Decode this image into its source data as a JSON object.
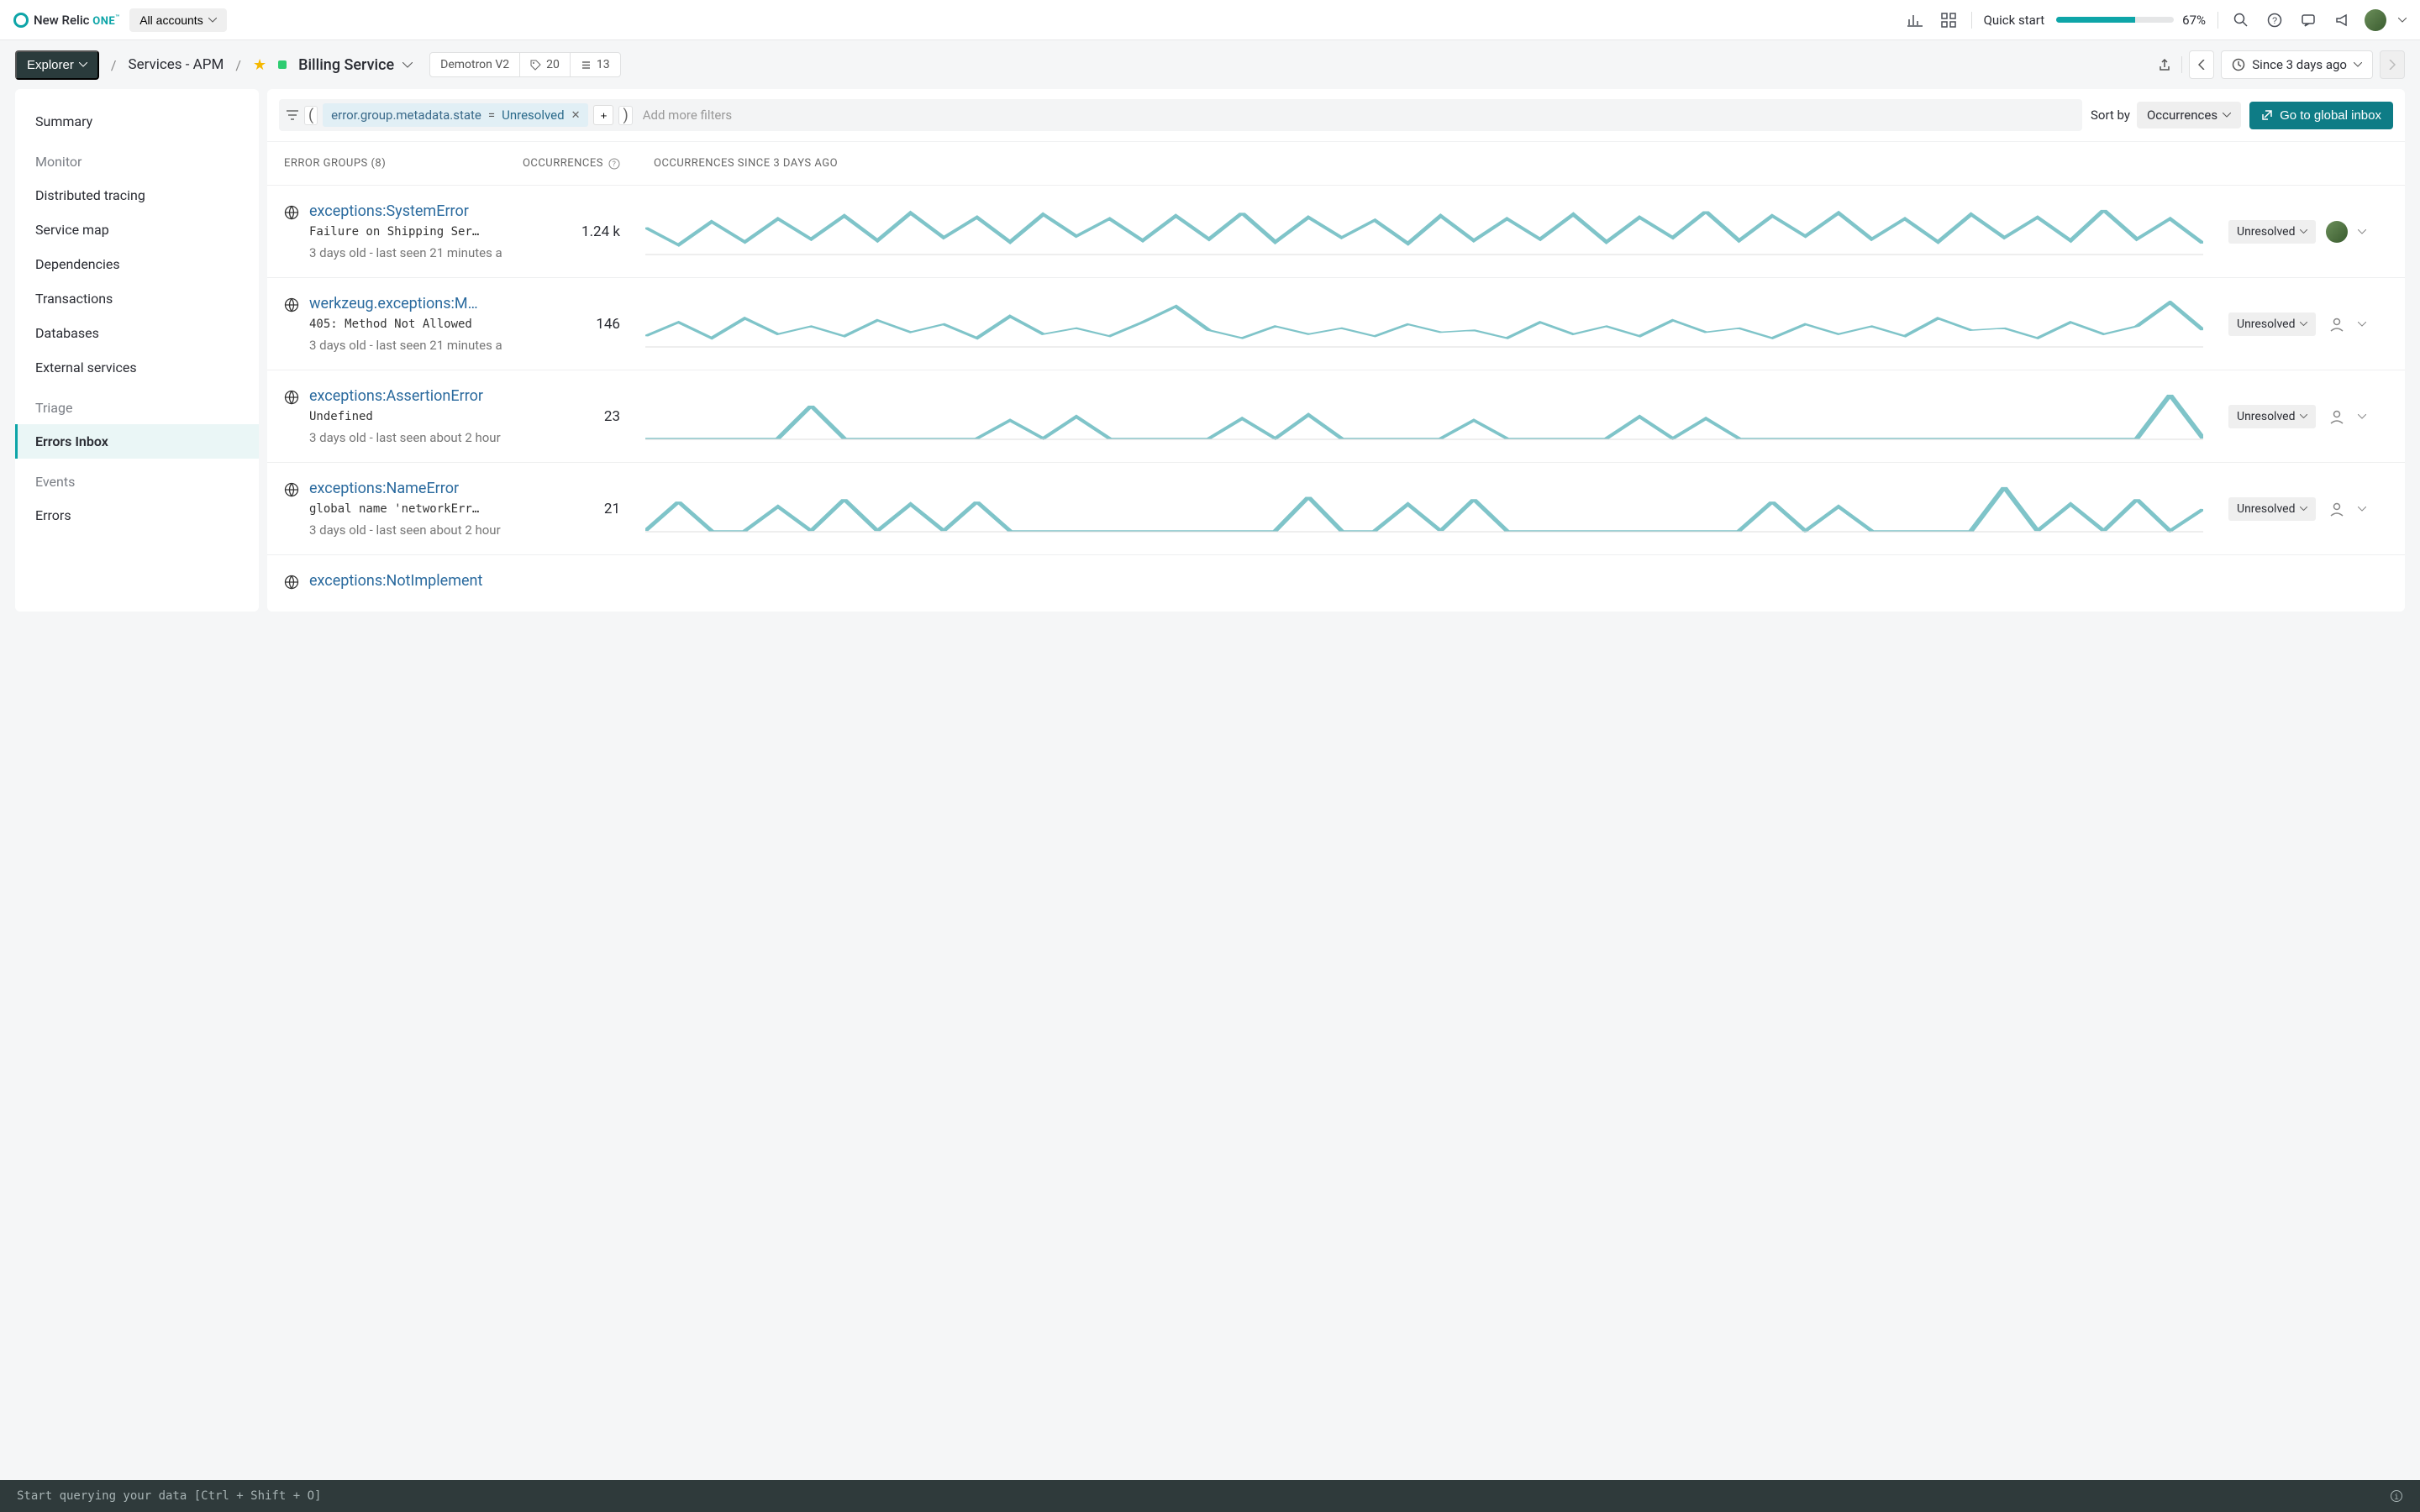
{
  "topbar": {
    "brand_prefix": "New Relic",
    "brand_suffix": "ONE",
    "brand_tm": "™",
    "accounts_label": "All accounts",
    "quick_start_label": "Quick start",
    "progress_pct": "67%",
    "progress_fill": 67
  },
  "crumbs": {
    "explorer": "Explorer",
    "services": "Services - APM",
    "service_name": "Billing Service",
    "env": "Demotron V2",
    "tag_count": "20",
    "entity_count": "13",
    "time_label": "Since 3 days ago"
  },
  "sidebar": {
    "summary": "Summary",
    "monitor_heading": "Monitor",
    "items": [
      "Distributed tracing",
      "Service map",
      "Dependencies",
      "Transactions",
      "Databases",
      "External services"
    ],
    "triage_heading": "Triage",
    "errors_inbox": "Errors Inbox",
    "events_heading": "Events",
    "errors": "Errors"
  },
  "filterbar": {
    "chip_key": "error.group.metadata.state",
    "chip_op": "=",
    "chip_val": "Unresolved",
    "placeholder": "Add more filters",
    "sort_label": "Sort by",
    "sort_value": "Occurrences",
    "global_btn": "Go to global inbox"
  },
  "tablehead": {
    "groups": "ERROR GROUPS (8)",
    "occurrences": "OCCURRENCES",
    "since": "OCCURRENCES SINCE 3 DAYS AGO"
  },
  "rows": [
    {
      "title": "exceptions:SystemError",
      "msg": "Failure on Shipping Serv…",
      "age": "3 days old - last seen 21 minutes a",
      "count": "1.24 k",
      "status": "Unresolved",
      "has_avatar": true
    },
    {
      "title": "werkzeug.exceptions:Meth",
      "msg": "405: Method Not Allowed",
      "age": "3 days old - last seen 21 minutes a",
      "count": "146",
      "status": "Unresolved",
      "has_avatar": false
    },
    {
      "title": "exceptions:AssertionError",
      "msg": "Undefined",
      "age": "3 days old - last seen about 2 hour",
      "count": "23",
      "status": "Unresolved",
      "has_avatar": false
    },
    {
      "title": "exceptions:NameError",
      "msg": "global name 'networkErro…",
      "age": "3 days old - last seen about 2 hour",
      "count": "21",
      "status": "Unresolved",
      "has_avatar": false
    },
    {
      "title": "exceptions:NotImplement",
      "msg": "",
      "age": "",
      "count": "",
      "status": "",
      "has_avatar": false
    }
  ],
  "querybar": {
    "text": "Start querying your data [Ctrl + Shift + O]"
  },
  "chart_data": {
    "type": "line",
    "note": "Sparkline trends per error group over 3 days; y values are relative occurrence counts (estimated from pixel heights).",
    "series": [
      {
        "name": "exceptions:SystemError",
        "values": [
          18,
          6,
          22,
          8,
          24,
          10,
          26,
          9,
          28,
          11,
          25,
          8,
          27,
          12,
          24,
          9,
          26,
          10,
          28,
          8,
          25,
          11,
          23,
          7,
          26,
          9,
          24,
          10,
          27,
          8,
          25,
          11,
          29,
          9,
          26,
          12,
          28,
          10,
          24,
          8,
          27,
          11,
          25,
          9,
          30,
          10,
          24,
          7
        ]
      },
      {
        "name": "werkzeug.exceptions:MethodNotAllowed",
        "values": [
          5,
          12,
          4,
          14,
          6,
          10,
          5,
          13,
          7,
          11,
          4,
          15,
          6,
          9,
          5,
          12,
          20,
          8,
          4,
          10,
          6,
          9,
          5,
          11,
          7,
          8,
          4,
          12,
          6,
          10,
          5,
          13,
          7,
          9,
          4,
          11,
          6,
          10,
          5,
          14,
          8,
          9,
          4,
          12,
          6,
          10,
          22,
          8
        ]
      },
      {
        "name": "exceptions:AssertionError",
        "values": [
          0,
          0,
          0,
          0,
          0,
          18,
          0,
          0,
          0,
          0,
          0,
          10,
          0,
          12,
          0,
          0,
          0,
          0,
          11,
          0,
          13,
          0,
          0,
          0,
          0,
          10,
          0,
          0,
          0,
          0,
          12,
          0,
          11,
          0,
          0,
          0,
          0,
          0,
          0,
          0,
          0,
          0,
          0,
          0,
          0,
          0,
          24,
          0
        ]
      },
      {
        "name": "exceptions:NameError",
        "values": [
          0,
          12,
          0,
          0,
          10,
          0,
          13,
          0,
          11,
          0,
          12,
          0,
          0,
          0,
          0,
          0,
          0,
          0,
          0,
          0,
          14,
          0,
          0,
          11,
          0,
          13,
          0,
          0,
          0,
          0,
          0,
          0,
          0,
          0,
          12,
          0,
          10,
          0,
          0,
          0,
          0,
          18,
          0,
          11,
          0,
          13,
          0,
          9
        ]
      }
    ]
  }
}
